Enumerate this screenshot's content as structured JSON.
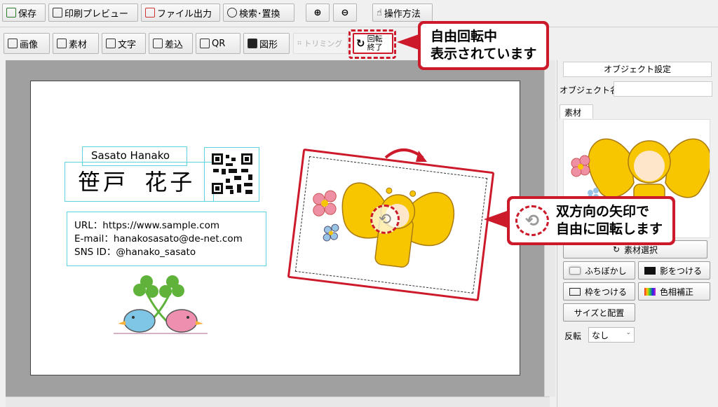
{
  "toolbar1": [
    {
      "name": "save-button",
      "icon": "save-icon",
      "label": "保存"
    },
    {
      "name": "print-preview-button",
      "icon": "printer-icon",
      "label": "印刷プレビュー"
    },
    {
      "name": "file-output-button",
      "icon": "file-export-icon",
      "label": "ファイル出力"
    },
    {
      "name": "search-replace-button",
      "icon": "search-icon",
      "label": "検索･置換"
    },
    {
      "name": "zoom-in-button",
      "icon": "zoom-in-icon",
      "label": ""
    },
    {
      "name": "zoom-out-button",
      "icon": "zoom-out-icon",
      "label": ""
    },
    {
      "name": "how-to-button",
      "icon": "hand-pointer-icon",
      "label": "操作方法"
    }
  ],
  "toolbar2": {
    "image": "画像",
    "material": "素材",
    "text": "文字",
    "merge": "差込",
    "qr": "QR",
    "shape": "図形",
    "trim": "トリミング",
    "rotate_end_1": "回転",
    "rotate_end_2": "終了"
  },
  "card": {
    "romaji": "Sasato Hanako",
    "name": "笹戸 花子",
    "url": "URL：https://www.sample.com",
    "email": "E-mail：hanakosasato@de-net.com",
    "sns": "SNS ID：@hanako_sasato"
  },
  "callouts": {
    "top_line1": "自由回転中",
    "top_line2": "表示されています",
    "right_line1": "双方向の矢印で",
    "right_line2": "自由に回転します"
  },
  "panel": {
    "title": "オブジェクト設定",
    "object_name_label": "オブジェクト名",
    "object_name_value": "",
    "material_tab": "素材",
    "select_material": "素材選択",
    "blur_edge": "ふちぼかし",
    "add_shadow": "影をつける",
    "add_frame": "枠をつける",
    "color_correct": "色相補正",
    "size_position": "サイズと配置",
    "flip_label": "反転",
    "flip_value": "なし"
  },
  "colors": {
    "accent_red": "#cc1a2b",
    "selection_cyan": "#5fd3e0",
    "butterfly_yellow": "#f7c600"
  }
}
